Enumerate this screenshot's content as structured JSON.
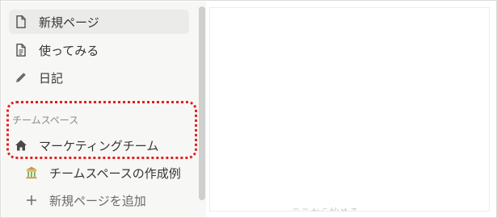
{
  "sidebar": {
    "items": [
      {
        "label": "新規ページ",
        "icon": "page-icon"
      },
      {
        "label": "使ってみる",
        "icon": "document-icon"
      },
      {
        "label": "日記",
        "icon": "pencil-icon"
      }
    ],
    "section": {
      "title": "チームスペース",
      "items": [
        {
          "label": "マーケティングチーム",
          "icon": "home-icon"
        },
        {
          "label": "チームスペースの作成例",
          "icon": "temple-icon"
        },
        {
          "label": "新規ページを追加",
          "icon": "plus-icon"
        }
      ]
    }
  },
  "main": {
    "hint": "ここから始める"
  },
  "colors": {
    "highlight": "#e02020",
    "sidebar_bg": "#f7f7f5",
    "text": "#37352f"
  }
}
